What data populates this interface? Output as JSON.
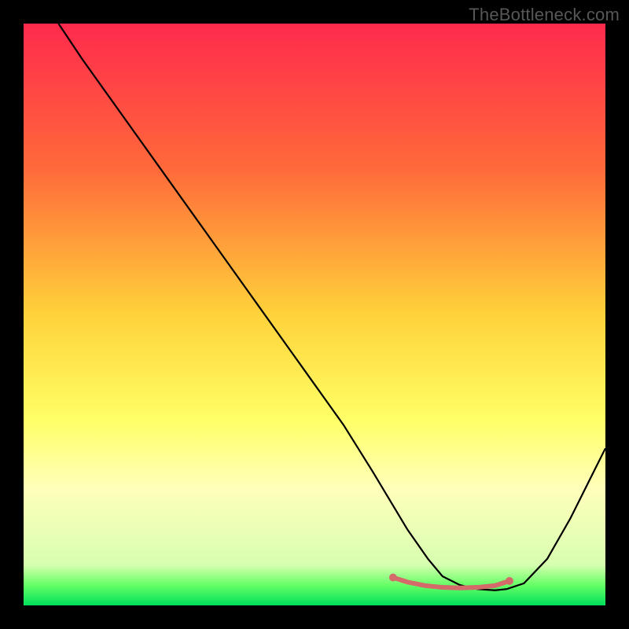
{
  "watermark": "TheBottleneck.com",
  "chart_data": {
    "type": "line",
    "title": "",
    "xlabel": "",
    "ylabel": "",
    "xlim": [
      0,
      100
    ],
    "ylim": [
      0,
      100
    ],
    "background_gradient": {
      "stops": [
        {
          "offset": 0,
          "color": "#ff2a4d"
        },
        {
          "offset": 0.25,
          "color": "#ff6a3a"
        },
        {
          "offset": 0.5,
          "color": "#ffd23a"
        },
        {
          "offset": 0.68,
          "color": "#ffff66"
        },
        {
          "offset": 0.8,
          "color": "#ffffbb"
        },
        {
          "offset": 0.93,
          "color": "#d7ffb0"
        },
        {
          "offset": 0.965,
          "color": "#66ff66"
        },
        {
          "offset": 1.0,
          "color": "#00e05a"
        }
      ]
    },
    "series": [
      {
        "name": "bottleneck-curve",
        "color": "#000000",
        "width": 2.2,
        "x": [
          6,
          10,
          15,
          20,
          25,
          30,
          35,
          40,
          45,
          50,
          55,
          60,
          63,
          66,
          69.5,
          72,
          75,
          78,
          81,
          83,
          86,
          90,
          94,
          98,
          100
        ],
        "values": [
          100,
          94,
          87,
          80,
          73,
          66,
          59,
          52,
          45,
          38,
          31,
          23,
          18,
          13,
          8,
          5,
          3.5,
          2.8,
          2.6,
          2.8,
          3.8,
          8,
          15,
          23,
          27
        ]
      }
    ],
    "highlight_band": {
      "name": "optimal-range",
      "color": "#d46a6a",
      "width": 6,
      "cap_radius": 5,
      "x": [
        63.5,
        66,
        69,
        72,
        75,
        78,
        81,
        83.5
      ],
      "values": [
        4.8,
        4.0,
        3.4,
        3.1,
        3.0,
        3.1,
        3.4,
        4.2
      ]
    }
  }
}
